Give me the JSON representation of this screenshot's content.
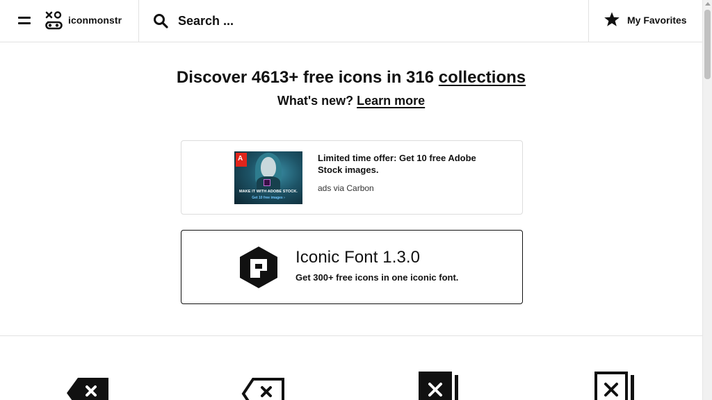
{
  "header": {
    "logo_text": "iconmonstr",
    "search": {
      "placeholder": "Search ...",
      "value": ""
    },
    "favorites_label": "My Favorites"
  },
  "hero": {
    "title_prefix": "Discover 4613+ free icons in 316 ",
    "title_link": "collections",
    "subtitle_prefix": "What's new? ",
    "subtitle_link": "Learn more"
  },
  "ad": {
    "text": "Limited time offer: Get 10 free Adobe Stock images.",
    "via": "ads via Carbon",
    "image_caption": "MAKE IT WITH ADOBE STOCK.",
    "image_subcaption": "Get 10 free images ›",
    "image_brand": "Adobe",
    "image_badge": "St"
  },
  "promo": {
    "title": "Iconic Font 1.3.0",
    "subtitle": "Get 300+ free icons in one iconic font."
  },
  "icons": [
    {
      "name": "backspace-filled-icon"
    },
    {
      "name": "backspace-outline-icon"
    },
    {
      "name": "delete-filled-icon"
    },
    {
      "name": "delete-outline-icon"
    }
  ],
  "colors": {
    "text": "#111111",
    "border": "#e2e2e2",
    "background": "#ffffff"
  }
}
